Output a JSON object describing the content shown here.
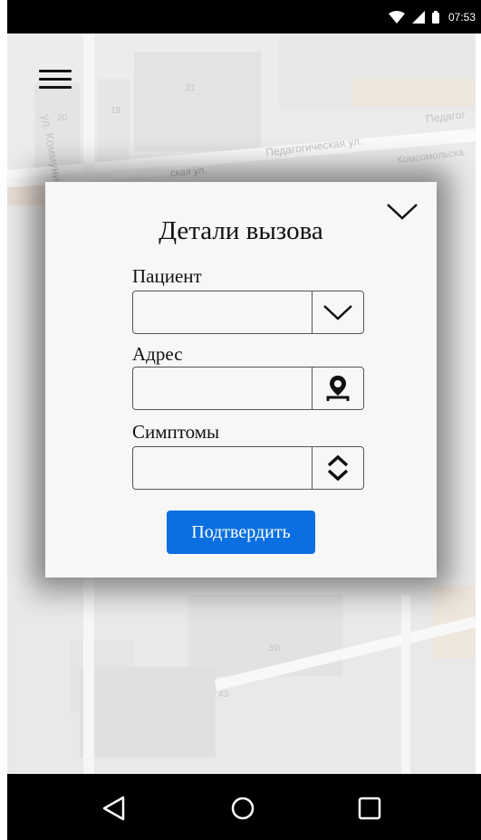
{
  "status_bar": {
    "time": "07:53",
    "icons": [
      "wifi-icon",
      "signal-icon",
      "battery-icon"
    ]
  },
  "map": {
    "street_labels": [
      "ул. Коммунистическая",
      "Педагогическая ул.",
      "Педагог",
      "Комсомольска",
      "ская ул."
    ],
    "building_numbers": [
      "21",
      "20",
      "19",
      "39г",
      "43"
    ]
  },
  "menu": {
    "icon": "hamburger-menu-icon"
  },
  "dialog": {
    "title": "Детали вызова",
    "collapse_icon": "chevron-down-icon",
    "fields": {
      "patient": {
        "label": "Пациент",
        "value": "",
        "button_icon": "chevron-down-icon"
      },
      "address": {
        "label": "Адрес",
        "value": "",
        "button_icon": "map-pin-icon"
      },
      "symptoms": {
        "label": "Симптомы",
        "value": "",
        "button_icon": "updown-chevron-icon"
      }
    },
    "confirm_label": "Подтвердить",
    "accent_color": "#0a6fe0"
  },
  "nav_bar": {
    "buttons": [
      "back-icon",
      "home-icon",
      "recents-icon"
    ]
  }
}
